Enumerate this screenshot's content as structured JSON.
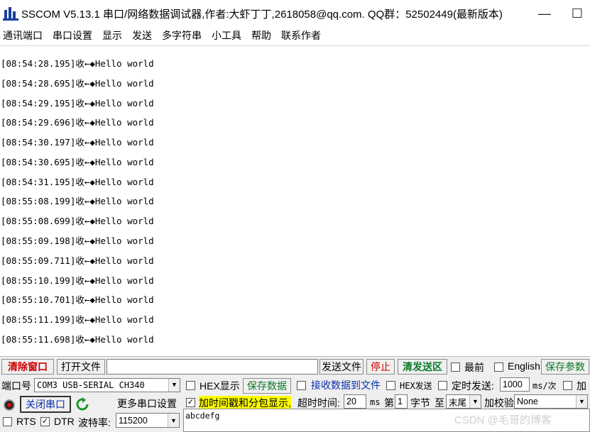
{
  "window": {
    "title": "SSCOM V5.13.1 串口/网络数据调试器,作者:大虾丁丁,2618058@qq.com. QQ群：52502449(最新版本)",
    "minimize": "—",
    "maximize": "☐"
  },
  "menu": [
    "通讯端口",
    "串口设置",
    "显示",
    "发送",
    "多字符串",
    "小工具",
    "帮助",
    "联系作者"
  ],
  "receive_log": [
    "[08:54:28.195]收←◆Hello world",
    "[08:54:28.695]收←◆Hello world",
    "[08:54:29.195]收←◆Hello world",
    "[08:54:29.696]收←◆Hello world",
    "[08:54:30.197]收←◆Hello world",
    "[08:54:30.695]收←◆Hello world",
    "[08:54:31.195]收←◆Hello world",
    "[08:55:08.199]收←◆Hello world",
    "[08:55:08.699]收←◆Hello world",
    "[08:55:09.198]收←◆Hello world",
    "[08:55:09.711]收←◆Hello world",
    "[08:55:10.199]收←◆Hello world",
    "[08:55:10.701]收←◆Hello world",
    "[08:55:11.199]收←◆Hello world",
    "[08:55:11.698]收←◆Hello world"
  ],
  "toolbar": {
    "clear_window": "清除窗口",
    "open_file": "打开文件",
    "file_path": "",
    "send_file": "发送文件",
    "stop": "停止",
    "clear_send": "清发送区",
    "topmost": "最前",
    "english": "English",
    "save_params": "保存参数"
  },
  "port": {
    "port_label": "端口号",
    "port_value": "COM3 USB-SERIAL CH340",
    "close_port": "关闭串口",
    "more_settings": "更多串口设置",
    "rts": "RTS",
    "dtr": "DTR",
    "baud_label": "波特率:",
    "baud_value": "115200",
    "dtr_checked": true,
    "rts_checked": false
  },
  "display": {
    "hex_display": "HEX显示",
    "save_data": "保存数据",
    "recv_to_file": "接收数据到文件",
    "timestamp": "加时间戳和分包显示,",
    "timeout_label": "超时时间:",
    "timeout_value": "20",
    "timeout_unit": "ms",
    "page_label": "第",
    "byte_value": "1",
    "byte_label": "字节",
    "to_label": "至",
    "tail_value": "末尾",
    "checksum_label": "加校验",
    "checksum_value": "None",
    "timestamp_checked": true
  },
  "send": {
    "hex_send": "HEX发送",
    "timed_send": "定时发送:",
    "interval_value": "1000",
    "interval_unit": "ms/次",
    "add_label": "加",
    "text": "abcdefg"
  },
  "watermark": "CSDN @毛哥的博客",
  "colors": {
    "accent_red": "#cc0000",
    "accent_green": "#0a7a28",
    "accent_blue": "#0a2fa8",
    "highlight": "#ffff00"
  }
}
